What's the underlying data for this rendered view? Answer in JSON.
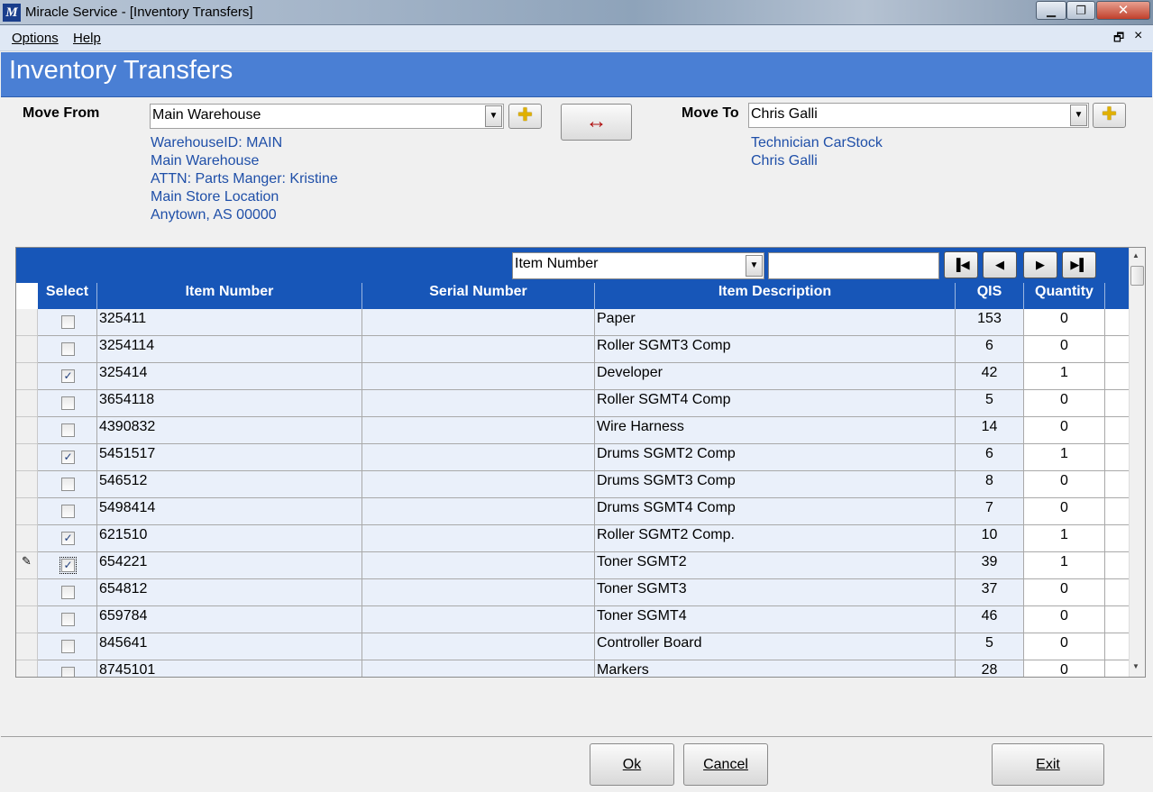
{
  "window": {
    "icon_text": "M",
    "title": "Miracle Service - [Inventory Transfers]"
  },
  "menu": {
    "options_label": "Options",
    "help_label": "Help"
  },
  "header": {
    "title": "Inventory Transfers"
  },
  "move_from": {
    "label": "Move From",
    "value": "Main Warehouse",
    "info": [
      "WarehouseID: MAIN",
      "Main Warehouse",
      "ATTN: Parts Manger: Kristine",
      "Main Store Location",
      "Anytown, AS 00000"
    ]
  },
  "move_to": {
    "label": "Move To",
    "value": "Chris Galli",
    "info": [
      "Technician CarStock",
      "Chris Galli"
    ]
  },
  "search": {
    "field": "Item Number",
    "value": ""
  },
  "columns": {
    "select": "Select",
    "item_number": "Item Number",
    "serial_number": "Serial Number",
    "item_description": "Item Description",
    "qis": "QIS",
    "quantity": "Quantity"
  },
  "rows": [
    {
      "checked": false,
      "item": "325411",
      "serial": "",
      "desc": "Paper",
      "qis": "153",
      "qty": "0",
      "editing": false
    },
    {
      "checked": false,
      "item": "3254114",
      "serial": "",
      "desc": "Roller SGMT3 Comp",
      "qis": "6",
      "qty": "0",
      "editing": false
    },
    {
      "checked": true,
      "item": "325414",
      "serial": "",
      "desc": "Developer",
      "qis": "42",
      "qty": "1",
      "editing": false
    },
    {
      "checked": false,
      "item": "3654118",
      "serial": "",
      "desc": "Roller SGMT4 Comp",
      "qis": "5",
      "qty": "0",
      "editing": false
    },
    {
      "checked": false,
      "item": "4390832",
      "serial": "",
      "desc": "Wire Harness",
      "qis": "14",
      "qty": "0",
      "editing": false
    },
    {
      "checked": true,
      "item": "5451517",
      "serial": "",
      "desc": "Drums SGMT2 Comp",
      "qis": "6",
      "qty": "1",
      "editing": false
    },
    {
      "checked": false,
      "item": "546512",
      "serial": "",
      "desc": "Drums SGMT3 Comp",
      "qis": "8",
      "qty": "0",
      "editing": false
    },
    {
      "checked": false,
      "item": "5498414",
      "serial": "",
      "desc": "Drums SGMT4 Comp",
      "qis": "7",
      "qty": "0",
      "editing": false
    },
    {
      "checked": true,
      "item": "621510",
      "serial": "",
      "desc": "Roller SGMT2 Comp.",
      "qis": "10",
      "qty": "1",
      "editing": false
    },
    {
      "checked": true,
      "item": "654221",
      "serial": "",
      "desc": "Toner SGMT2",
      "qis": "39",
      "qty": "1",
      "editing": true
    },
    {
      "checked": false,
      "item": "654812",
      "serial": "",
      "desc": "Toner SGMT3",
      "qis": "37",
      "qty": "0",
      "editing": false
    },
    {
      "checked": false,
      "item": "659784",
      "serial": "",
      "desc": "Toner SGMT4",
      "qis": "46",
      "qty": "0",
      "editing": false
    },
    {
      "checked": false,
      "item": "845641",
      "serial": "",
      "desc": "Controller Board",
      "qis": "5",
      "qty": "0",
      "editing": false
    },
    {
      "checked": false,
      "item": "8745101",
      "serial": "",
      "desc": "Markers",
      "qis": "28",
      "qty": "0",
      "editing": false
    }
  ],
  "buttons": {
    "ok": "Ok",
    "cancel": "Cancel",
    "exit": "Exit"
  },
  "colors": {
    "header_bg": "#4a7fd4",
    "grid_header_bg": "#1756b8",
    "info_text": "#1f4fa8",
    "swap_arrow": "#b01010"
  },
  "icons": {
    "swap": "left-right-arrow-icon",
    "add": "plus-icon",
    "nav": [
      "first-page-icon",
      "previous-page-icon",
      "next-page-icon",
      "last-page-icon"
    ]
  }
}
